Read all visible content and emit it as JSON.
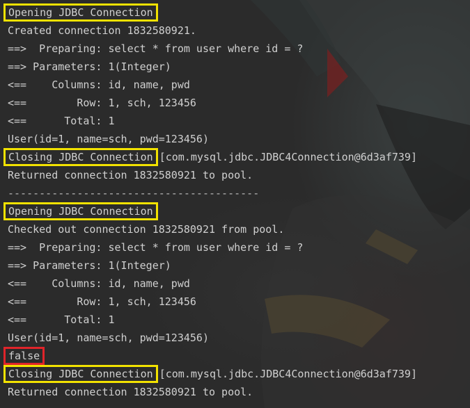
{
  "console": {
    "lines": [
      {
        "type": "boxed",
        "box_color": "#f2e200",
        "boxed": "Opening JDBC Connection",
        "rest": ""
      },
      {
        "type": "text",
        "text": "Created connection 1832580921."
      },
      {
        "type": "text",
        "text": "==>  Preparing: select * from user where id = ?"
      },
      {
        "type": "text",
        "text": "==> Parameters: 1(Integer)"
      },
      {
        "type": "text",
        "text": "<==    Columns: id, name, pwd"
      },
      {
        "type": "text",
        "text": "<==        Row: 1, sch, 123456"
      },
      {
        "type": "text",
        "text": "<==      Total: 1"
      },
      {
        "type": "text",
        "text": "User(id=1, name=sch, pwd=123456)"
      },
      {
        "type": "boxed",
        "box_color": "#f2e200",
        "boxed": "Closing JDBC Connection",
        "rest": "[com.mysql.jdbc.JDBC4Connection@6d3af739]"
      },
      {
        "type": "text",
        "text": "Returned connection 1832580921 to pool."
      },
      {
        "type": "separator",
        "text": "----------------------------------------"
      },
      {
        "type": "boxed",
        "box_color": "#f2e200",
        "boxed": "Opening JDBC Connection",
        "rest": ""
      },
      {
        "type": "text",
        "text": "Checked out connection 1832580921 from pool."
      },
      {
        "type": "text",
        "text": "==>  Preparing: select * from user where id = ?"
      },
      {
        "type": "text",
        "text": "==> Parameters: 1(Integer)"
      },
      {
        "type": "text",
        "text": "<==    Columns: id, name, pwd"
      },
      {
        "type": "text",
        "text": "<==        Row: 1, sch, 123456"
      },
      {
        "type": "text",
        "text": "<==      Total: 1"
      },
      {
        "type": "text",
        "text": "User(id=1, name=sch, pwd=123456)"
      },
      {
        "type": "boxed",
        "box_color": "#e0242a",
        "boxed": "false",
        "rest": ""
      },
      {
        "type": "boxed",
        "box_color": "#f2e200",
        "boxed": "Closing JDBC Connection",
        "rest": "[com.mysql.jdbc.JDBC4Connection@6d3af739]"
      },
      {
        "type": "text",
        "text": "Returned connection 1832580921 to pool."
      }
    ]
  }
}
